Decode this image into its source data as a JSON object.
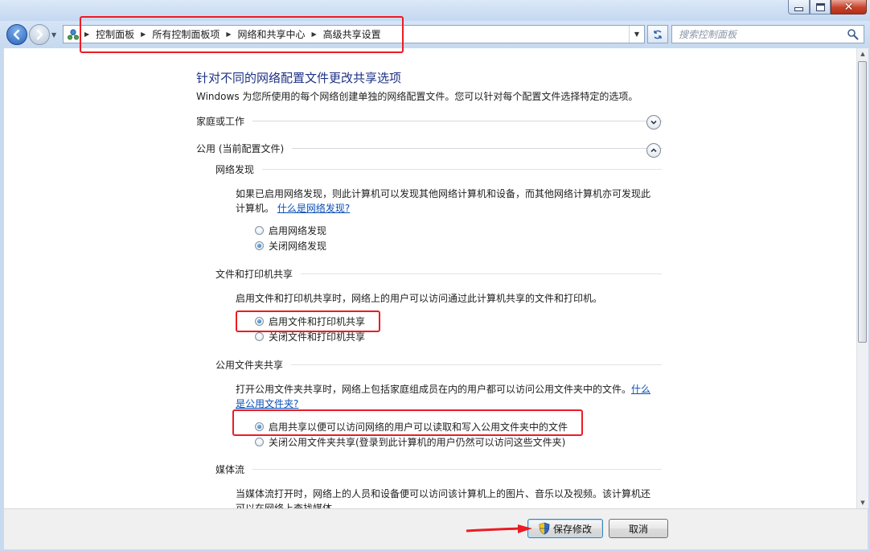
{
  "nav": {
    "breadcrumbs": [
      "控制面板",
      "所有控制面板项",
      "网络和共享中心",
      "高级共享设置"
    ],
    "search_placeholder": "搜索控制面板"
  },
  "page": {
    "title": "针对不同的网络配置文件更改共享选项",
    "description": "Windows 为您所使用的每个网络创建单独的网络配置文件。您可以针对每个配置文件选择特定的选项。"
  },
  "profiles": {
    "home": {
      "label": "家庭或工作",
      "expanded": false
    },
    "public": {
      "label": "公用 (当前配置文件)",
      "expanded": true
    }
  },
  "sections": {
    "network_discovery": {
      "title": "网络发现",
      "desc_line1": "如果已启用网络发现，则此计算机可以发现其他网络计算机和设备，而其他网络计算机亦可发现此",
      "desc_line2": "计算机。",
      "link": "什么是网络发现?",
      "options": [
        {
          "label": "启用网络发现",
          "selected": false
        },
        {
          "label": "关闭网络发现",
          "selected": true
        }
      ]
    },
    "file_printer_sharing": {
      "title": "文件和打印机共享",
      "desc": "启用文件和打印机共享时，网络上的用户可以访问通过此计算机共享的文件和打印机。",
      "options": [
        {
          "label": "启用文件和打印机共享",
          "selected": true
        },
        {
          "label": "关闭文件和打印机共享",
          "selected": false
        }
      ]
    },
    "public_folder_sharing": {
      "title": "公用文件夹共享",
      "desc_line1": "打开公用文件夹共享时，网络上包括家庭组成员在内的用户都可以访问公用文件夹中的文件。",
      "link_part1": "什么",
      "link_part2": "是公用文件夹?",
      "options": [
        {
          "label": "启用共享以便可以访问网络的用户可以读取和写入公用文件夹中的文件",
          "selected": true
        },
        {
          "label": "关闭公用文件夹共享(登录到此计算机的用户仍然可以访问这些文件夹)",
          "selected": false
        }
      ]
    },
    "media_streaming": {
      "title": "媒体流",
      "desc_line1": "当媒体流打开时，网络上的人员和设备便可以访问该计算机上的图片、音乐以及视频。该计算机还",
      "desc_line2": "可以在网络上查找媒体。"
    }
  },
  "footer": {
    "save_label": "保存修改",
    "cancel_label": "取消"
  },
  "colors": {
    "highlight": "#ea1c24",
    "title": "#1e3287",
    "link": "#0b4fb7"
  }
}
